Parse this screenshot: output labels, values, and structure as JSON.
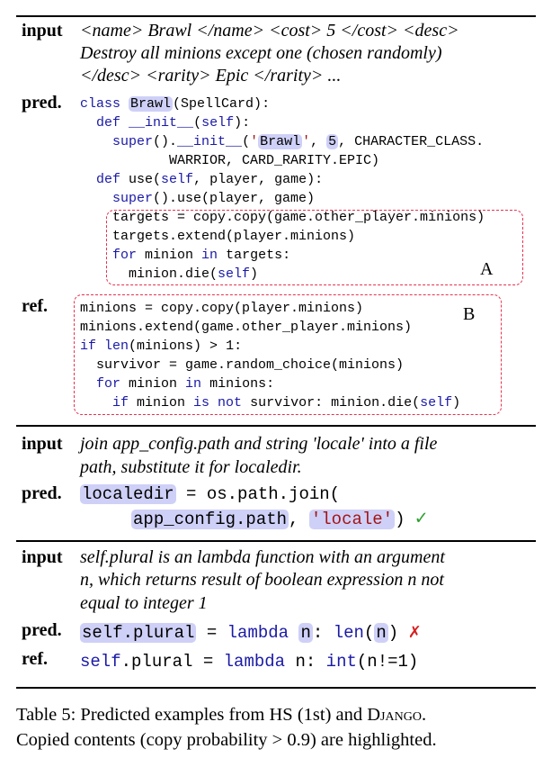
{
  "ex1": {
    "input_label": "input",
    "input_lines": [
      "<name> Brawl </name> <cost> 5 </cost> <desc>",
      "Destroy all minions except one (chosen randomly)",
      "</desc> <rarity> Epic </rarity> ..."
    ],
    "pred_label": "pred.",
    "ref_label": "ref.",
    "box_a_label": "A",
    "box_b_label": "B"
  },
  "ex2": {
    "input_label": "input",
    "input_lines": [
      "join app_config.path and string 'locale' into a file",
      "path, substitute it for localedir."
    ],
    "pred_label": "pred.",
    "pred_mark": "✓"
  },
  "ex3": {
    "input_label": "input",
    "input_lines": [
      "self.plural is an lambda function with an argument",
      "n, which returns result of boolean expression n not",
      "equal to integer 1"
    ],
    "pred_label": "pred.",
    "pred_mark": "✗",
    "ref_label": "ref."
  },
  "caption": {
    "line1_prefix": "Table 5: Predicted examples from HS (1st) and ",
    "line1_sc": "Django",
    "line1_suffix": ".",
    "line2": "Copied contents (copy probability > 0.9) are highlighted."
  }
}
